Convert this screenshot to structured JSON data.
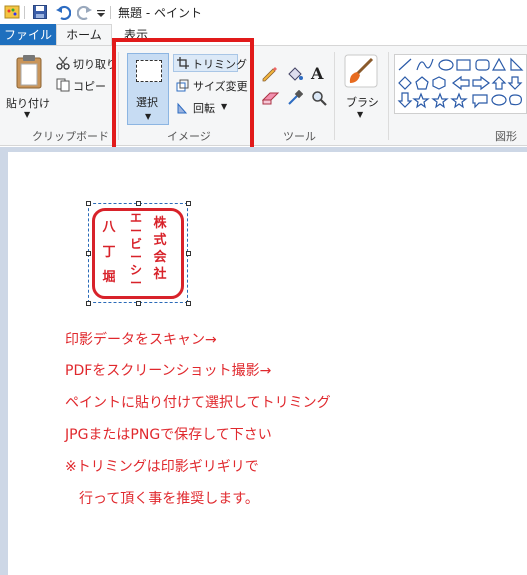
{
  "window": {
    "title": "無題 - ペイント"
  },
  "tabs": {
    "file": "ファイル",
    "home": "ホーム",
    "view": "表示"
  },
  "ribbon": {
    "clipboard": {
      "paste": "貼り付け",
      "cut": "切り取り",
      "copy": "コピー",
      "group_label": "クリップボード"
    },
    "image": {
      "select": "選択",
      "trim": "トリミング",
      "resize": "サイズ変更",
      "rotate": "回転",
      "group_label": "イメージ"
    },
    "tools": {
      "group_label": "ツール"
    },
    "brush": {
      "label": "ブラシ"
    },
    "shapes": {
      "group_label": "図形"
    }
  },
  "stamp": {
    "column_right": "株式会社",
    "column_middle": "エービーシー",
    "column_left": "八丁堀",
    "color": "#d8222a"
  },
  "instructions": [
    "印影データをスキャン→",
    "PDFをスクリーンショット撮影→",
    "ペイントに貼り付けて選択してトリミング",
    "JPGまたはPNGで保存して下さい",
    "※トリミングは印影ギリギリで",
    "　行って頂く事を推奨します。"
  ],
  "colors": {
    "accent": "#1e6fbe",
    "highlight_frame": "#e11a1a",
    "instruction_text": "#e0282d"
  }
}
